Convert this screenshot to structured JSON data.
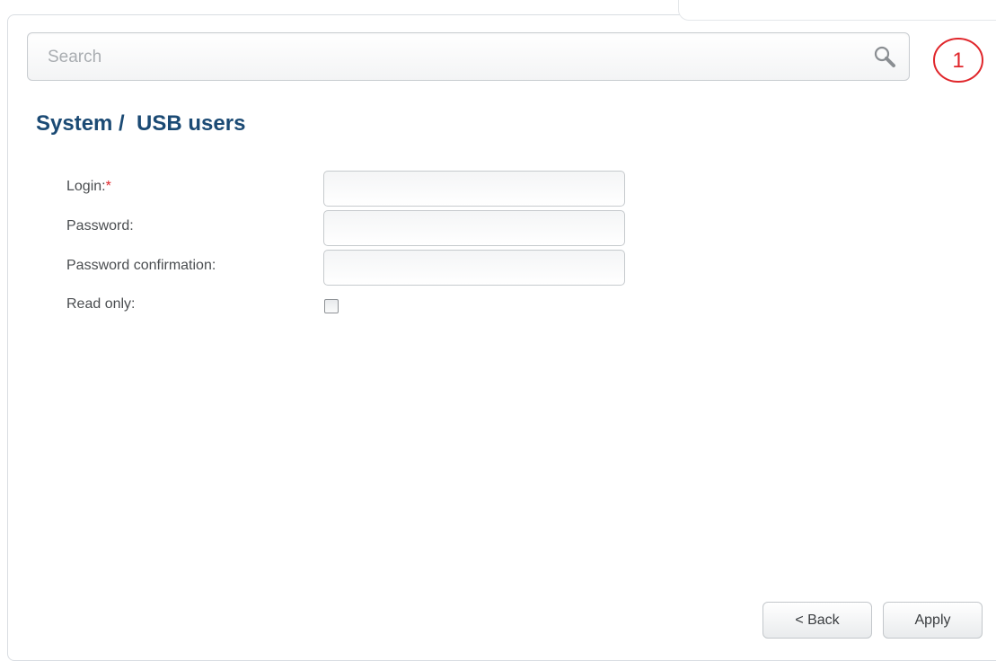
{
  "search": {
    "placeholder": "Search",
    "value": "",
    "icon": "search-icon"
  },
  "callout": {
    "number": "1",
    "color": "#e0262b"
  },
  "page": {
    "title": "System /  USB users",
    "title_color": "#1b4a74"
  },
  "form": {
    "login": {
      "label": "Login:",
      "required_marker": "*",
      "value": ""
    },
    "password": {
      "label": "Password:",
      "value": ""
    },
    "password_confirmation": {
      "label": "Password confirmation:",
      "value": ""
    },
    "read_only": {
      "label": "Read only:",
      "checked": false
    }
  },
  "buttons": {
    "back": "< Back",
    "apply": "Apply"
  }
}
